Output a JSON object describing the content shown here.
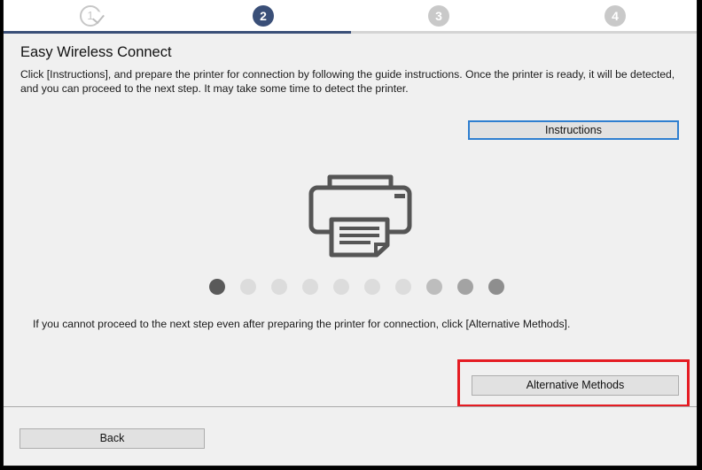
{
  "steps": [
    {
      "number": "1",
      "state": "done"
    },
    {
      "number": "2",
      "state": "current"
    },
    {
      "number": "3",
      "state": "future"
    },
    {
      "number": "4",
      "state": "future"
    }
  ],
  "heading": "Easy Wireless Connect",
  "description": "Click [Instructions], and prepare the printer for connection by following the guide instructions. Once the printer is ready, it will be detected, and you can proceed to the next step. It may take some time to detect the printer.",
  "buttons": {
    "instructions": "Instructions",
    "alternative_methods": "Alternative Methods",
    "back": "Back"
  },
  "illustration": {
    "icon": "printer-icon"
  },
  "progress_dots": {
    "count": 10,
    "colors": [
      "#5a5a5a",
      "#dcdcdc",
      "#dcdcdc",
      "#dcdcdc",
      "#dcdcdc",
      "#dcdcdc",
      "#dcdcdc",
      "#bdbdbd",
      "#a3a3a3",
      "#8e8e8e"
    ]
  },
  "note": "If you cannot proceed to the next step even after preparing the printer for connection, click [Alternative Methods].",
  "colors": {
    "step_current": "#3a4f78",
    "step_future": "#c9c9c9",
    "focus_border": "#2f7fd0",
    "highlight": "#e51c23"
  }
}
